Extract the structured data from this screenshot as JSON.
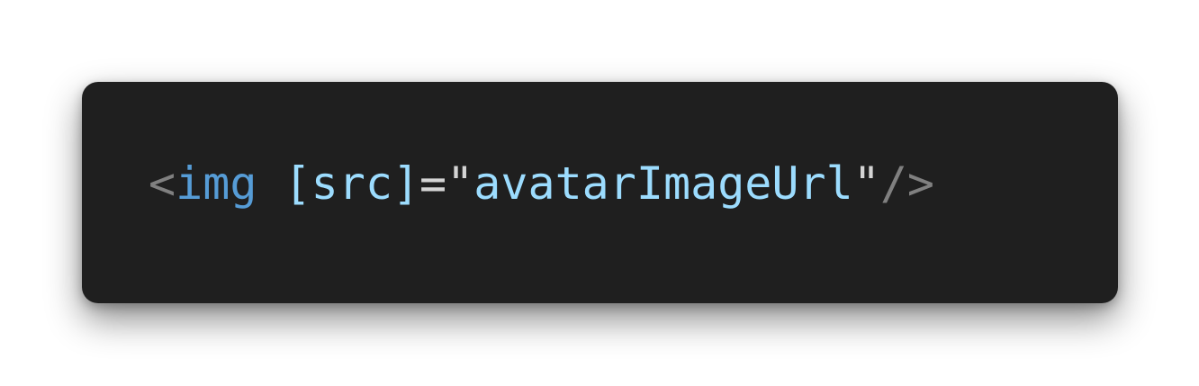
{
  "code_snippet": {
    "tokens": {
      "open_bracket": "<",
      "tag_name": "img",
      "space": " ",
      "attr_binding": "[src]",
      "equals": "=",
      "quote_open": "\"",
      "attr_value": "avatarImageUrl",
      "quote_close": "\"",
      "self_close": "/>"
    },
    "colors": {
      "background": "#1f1f1f",
      "punctuation": "#808080",
      "tag_name": "#569cd6",
      "attribute": "#9cdcfe",
      "value": "#9cdcfe",
      "quote": "#d4d4d4",
      "equals": "#d4d4d4"
    }
  }
}
